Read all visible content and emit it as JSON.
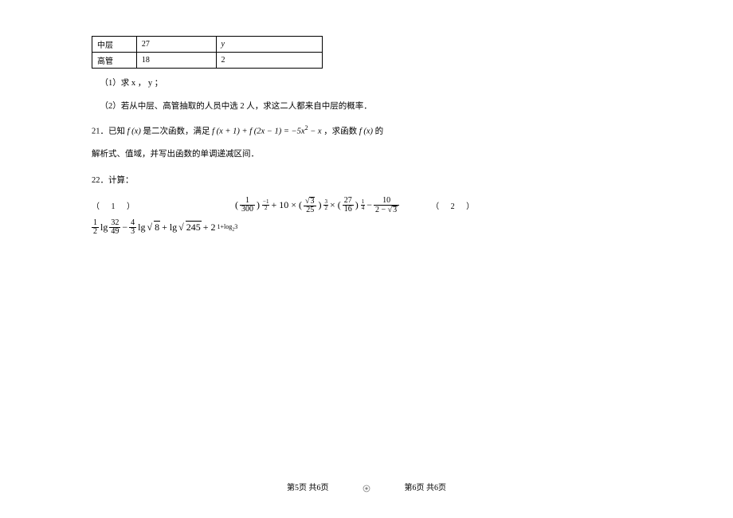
{
  "table": {
    "rows": [
      {
        "c1": "中层",
        "c2": "27",
        "c3": "y"
      },
      {
        "c1": "高管",
        "c2": "18",
        "c3": "2"
      }
    ]
  },
  "q_part1": "（1）求 x ， y ；",
  "q_part2": "（2）若从中层、高管抽取的人员中选 2 人，求这二人都来自中层的概率．",
  "q21": {
    "prefix": "21．已知",
    "f_of_x": "f (x)",
    "mid1": "是二次函数，满足",
    "expr_lhs1": "f (x + 1) + f (2x − 1) = −5x",
    "expr_sup": "2",
    "expr_tail": " − x",
    "mid2": "，求函数",
    "f_of_x2": "f (x)",
    "suffix1": "的",
    "line2": "解析式、值域，并写出函数的单调递减区间．"
  },
  "q22": {
    "prefix": "22．计算：",
    "label1": "（ 1 ）",
    "label2": "（ 2 ）",
    "f1": {
      "frac1_num": "1",
      "frac1_den": "300",
      "exp1_sign": "−",
      "exp1_num": "1",
      "exp1_den": "2",
      "plus10": " + 10 × (",
      "sqrt3": "3",
      "frac2_den": "25",
      "exp2_num": "3",
      "exp2_den": "2",
      "times": " × (",
      "frac3_num": "27",
      "frac3_den": "16",
      "exp3_num": "1",
      "exp3_den": "4",
      "minus": " − ",
      "frac4_num": "10",
      "frac4_den_pre": "2 − ",
      "frac4_den_sqrt": "3"
    },
    "f2": {
      "frac1_num": "1",
      "frac1_den": "2",
      "lg1": " lg ",
      "frac2_num": "32",
      "frac2_den": "49",
      "minus": " − ",
      "frac3_num": "4",
      "frac3_den": "3",
      "lg2": " lg ",
      "sqrt8": "8",
      "plus_lg": " + lg ",
      "sqrt245": "245",
      "plus2": " + 2",
      "exp_1plus": "1+log",
      "exp_sub": "2",
      "exp_3": "3"
    }
  },
  "footer": {
    "left": "第5页 共6页",
    "right": "第6页 共6页"
  }
}
